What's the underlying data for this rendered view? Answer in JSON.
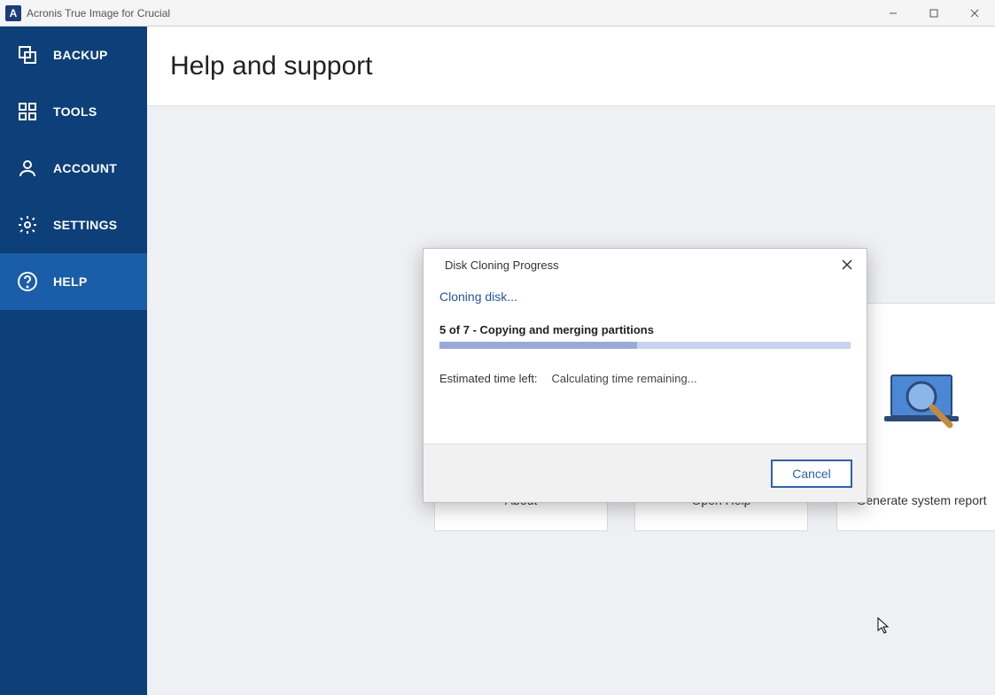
{
  "titlebar": {
    "app_name": "Acronis True Image for Crucial",
    "app_icon_letter": "A"
  },
  "sidebar": {
    "items": [
      {
        "label": "BACKUP",
        "icon": "backup"
      },
      {
        "label": "TOOLS",
        "icon": "tools"
      },
      {
        "label": "ACCOUNT",
        "icon": "account"
      },
      {
        "label": "SETTINGS",
        "icon": "settings"
      },
      {
        "label": "HELP",
        "icon": "help"
      }
    ],
    "active_index": 4
  },
  "page": {
    "title": "Help and support"
  },
  "cards": {
    "about_label": "About",
    "open_help_label": "Open Help",
    "sys_report_label": "Generate system report"
  },
  "dialog": {
    "title": "Disk Cloning Progress",
    "status_line": "Cloning disk...",
    "step_text": "5 of 7 - Copying and merging partitions",
    "est_label": "Estimated time left:",
    "est_value": "Calculating time remaining...",
    "cancel_label": "Cancel",
    "progress_percent": 48
  }
}
